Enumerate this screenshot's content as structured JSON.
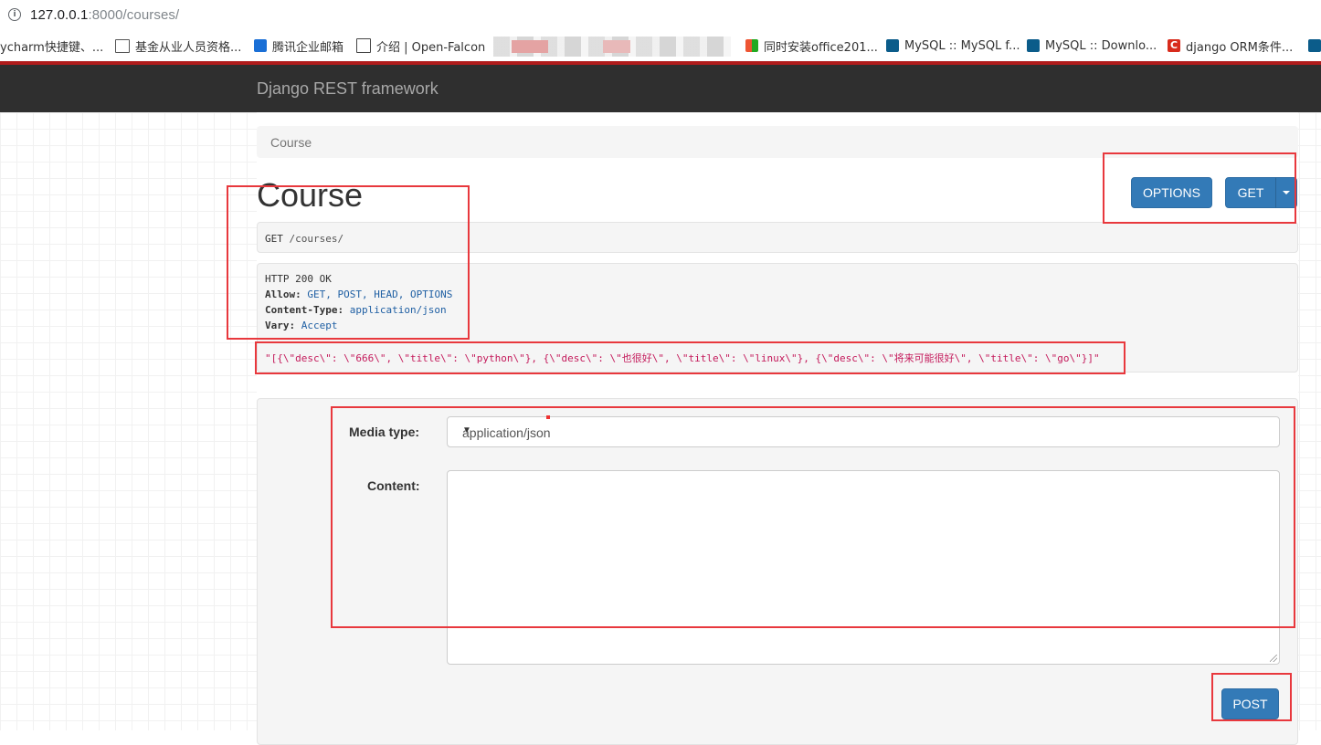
{
  "browser": {
    "url_host": "127.0.0.1",
    "url_rest": ":8000/courses/",
    "bookmarks": [
      {
        "label": "ycharm快捷键、...",
        "icon": "none"
      },
      {
        "label": "基金从业人员资格...",
        "icon": "page-icon"
      },
      {
        "label": "腾讯企业邮箱",
        "icon": "tencent-mail-icon"
      },
      {
        "label": "介绍 | Open-Falcon",
        "icon": "book-icon"
      },
      {
        "label": "同时安装office201...",
        "icon": "office-icon"
      },
      {
        "label": "MySQL :: MySQL f...",
        "icon": "mysql-icon"
      },
      {
        "label": "MySQL :: Downlo...",
        "icon": "mysql-icon"
      },
      {
        "label": "django ORM条件...",
        "icon": "csdn-icon"
      }
    ]
  },
  "navbar": {
    "brand": "Django REST framework"
  },
  "breadcrumb": {
    "item": "Course"
  },
  "page": {
    "title": "Course"
  },
  "toolbar": {
    "options_label": "OPTIONS",
    "get_label": "GET"
  },
  "request": {
    "method": "GET",
    "path": "/courses/"
  },
  "response": {
    "status": "HTTP 200 OK",
    "allow_key": "Allow:",
    "allow_value": "GET, POST, HEAD, OPTIONS",
    "content_type_key": "Content-Type:",
    "content_type_value": "application/json",
    "vary_key": "Vary:",
    "vary_value": "Accept",
    "body": "\"[{\\\"desc\\\": \\\"666\\\", \\\"title\\\": \\\"python\\\"}, {\\\"desc\\\": \\\"也很好\\\", \\\"title\\\": \\\"linux\\\"}, {\\\"desc\\\": \\\"将来可能很好\\\", \\\"title\\\": \\\"go\\\"}]\""
  },
  "form": {
    "media_type_label": "Media type:",
    "media_type_value": "application/json",
    "content_label": "Content:",
    "post_label": "POST"
  },
  "colors": {
    "navbar": "#2f2f2f",
    "primary_button": "#337ab7",
    "annotation": "#e8383d",
    "json_string": "#c41a5b"
  }
}
